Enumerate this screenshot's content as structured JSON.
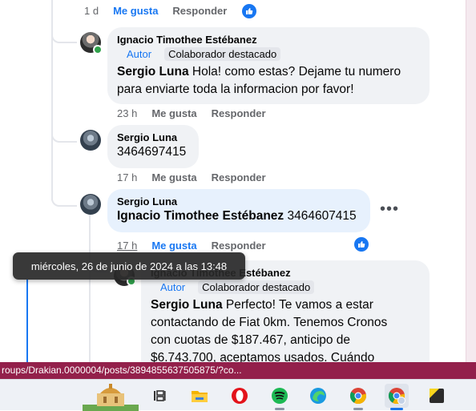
{
  "actions": {
    "like": "Me gusta",
    "reply": "Responder"
  },
  "comments": [
    {
      "time": "1 d"
    },
    {
      "author": "Ignacio Timothee Estébanez",
      "author_badge": "Autor",
      "tag": "Colaborador destacado",
      "mention": "Sergio Luna",
      "line1": "Hola! como estas? Dejame tu numero",
      "line2": "para enviarte toda la informacion por favor!",
      "time": "23 h"
    },
    {
      "author": "Sergio Luna",
      "text": "3464697415",
      "time": "17 h"
    },
    {
      "author": "Sergio Luna",
      "mention": "Ignacio Timothee Estébanez",
      "text": "3464607415",
      "time": "17 h",
      "more": "•••"
    },
    {
      "author": "Ignacio Timothee Estébanez",
      "author_badge": "Autor",
      "tag": "Colaborador destacado",
      "mention": "Sergio Luna",
      "line1": "Perfecto! Te vamos a estar",
      "line2": "contactando de Fiat 0km. Tenemos Cronos",
      "line3": "con cuotas de $187.467, anticipo de",
      "line4": "$6.743.700, aceptamos usados. Cuándo"
    }
  ],
  "tooltip": "miércoles, 26 de junio de 2024 a las 13:48",
  "status_url": "roups/Drakian.0000004/posts/3894855637505875/?co...",
  "taskbar": {
    "items": [
      "task-view-icon",
      "file-explorer-icon",
      "opera-icon",
      "spotify-icon",
      "edge-icon",
      "chrome-icon",
      "chrome-profile-icon",
      "sticky-notes-icon"
    ]
  },
  "colors": {
    "accent": "#1877f2",
    "status_bar": "#93204b",
    "bubble": "#f0f2f5"
  }
}
